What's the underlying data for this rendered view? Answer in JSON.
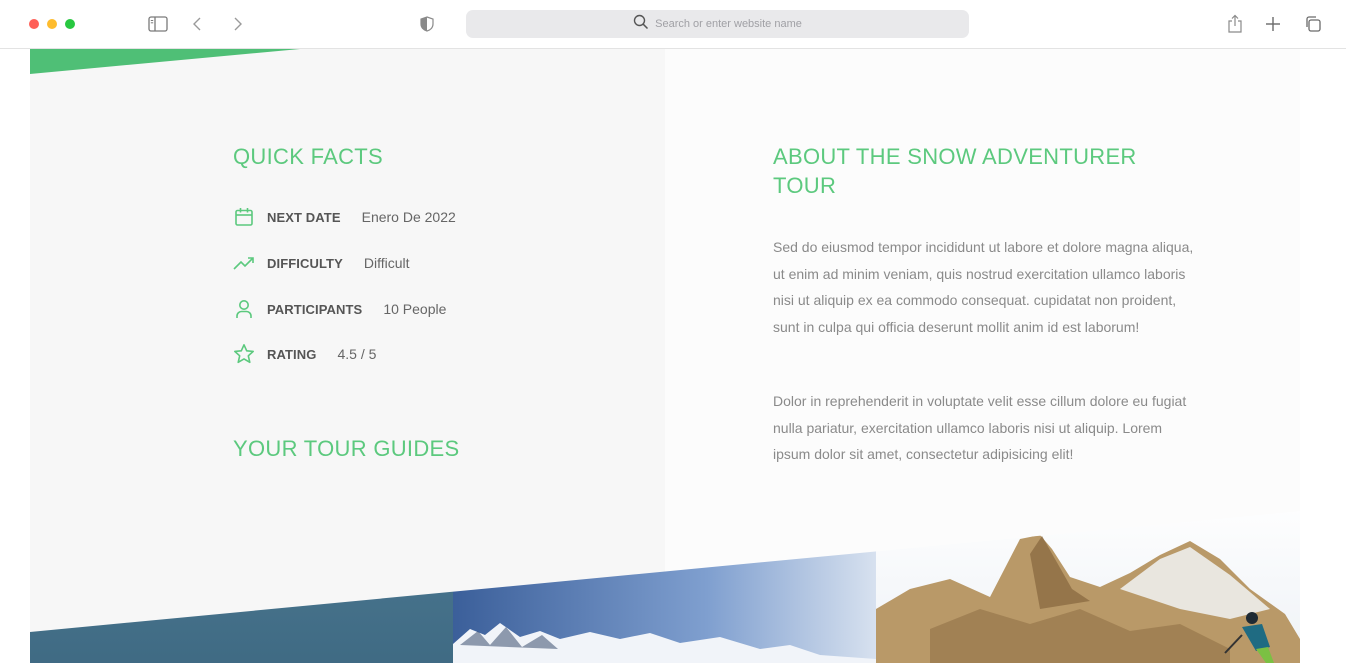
{
  "browser": {
    "search_placeholder": "Search or enter website name",
    "icons": [
      "sidebar-icon",
      "back-icon",
      "forward-icon",
      "shield-icon",
      "search-icon",
      "share-icon",
      "plus-icon",
      "tabs-icon"
    ]
  },
  "colors": {
    "accent": "#5cc97e",
    "panel_left": "#f7f7f7",
    "panel_right": "#fcfcfc"
  },
  "quick_facts": {
    "title": "QUICK FACTS",
    "items": [
      {
        "icon": "calendar-icon",
        "label": "NEXT DATE",
        "value": "Enero De 2022"
      },
      {
        "icon": "trending-up-icon",
        "label": "DIFFICULTY",
        "value": "Difficult"
      },
      {
        "icon": "user-icon",
        "label": "PARTICIPANTS",
        "value": "10 People"
      },
      {
        "icon": "star-icon",
        "label": "RATING",
        "value": "4.5 / 5"
      }
    ]
  },
  "guides": {
    "title": "YOUR TOUR GUIDES"
  },
  "about": {
    "title_line1": "ABOUT THE SNOW ADVENTURER",
    "title_line2": "TOUR",
    "paragraphs": [
      "Sed do eiusmod tempor incididunt ut labore et dolore magna aliqua, ut enim ad minim veniam, quis nostrud exercitation ullamco laboris nisi ut aliquip ex ea commodo consequat. cupidatat non proident, sunt in culpa qui officia deserunt mollit anim id est laborum!",
      "Dolor in reprehenderit in voluptate velit esse cillum dolore eu fugiat nulla pariatur, exercitation ullamco laboris nisi ut aliquip. Lorem ipsum dolor sit amet, consectetur adipisicing elit!"
    ]
  }
}
